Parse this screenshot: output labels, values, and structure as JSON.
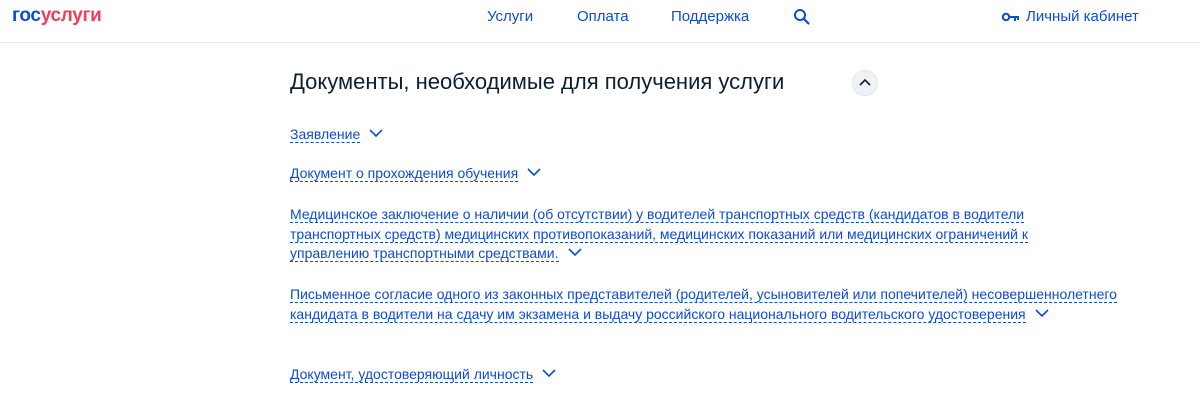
{
  "header": {
    "logo_part1": "гос",
    "logo_part2": "услуги",
    "nav": {
      "services": "Услуги",
      "payment": "Оплата",
      "support": "Поддержка"
    },
    "cabinet_label": "Личный кабинет",
    "icons": {
      "search": "search-icon",
      "key": "key-icon"
    }
  },
  "main": {
    "section_title": "Документы, необходимые для получения услуги",
    "collapse_icon": "chevron-up-icon",
    "documents": [
      {
        "label": "Заявление"
      },
      {
        "label": "Документ о прохождения обучения"
      },
      {
        "label": "Медицинское заключение о наличии (об отсутствии) у водителей транспортных средств (кандидатов в водители транспортных средств) медицинских противопоказаний, медицинских показаний или медицинских ограничений к управлению транспортными средствами."
      },
      {
        "label": "Письменное согласие одного из законных представителей (родителей, усыновителей или попечителей) несовершеннолетнего кандидата в водители на сдачу им экзамена и выдачу российского национального водительского удостоверения"
      },
      {
        "label": "Документ, удостоверяющий личность"
      }
    ]
  },
  "colors": {
    "link": "#0d4cd3",
    "brand_red": "#ee3f58",
    "text": "#0b1f33"
  }
}
